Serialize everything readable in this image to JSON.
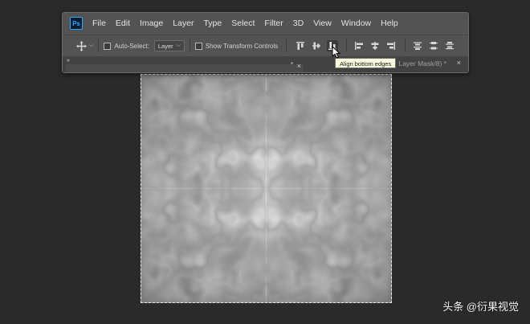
{
  "app": {
    "logo_text": "Ps"
  },
  "menu": [
    "File",
    "Edit",
    "Image",
    "Layer",
    "Type",
    "Select",
    "Filter",
    "3D",
    "View",
    "Window",
    "Help"
  ],
  "options_bar": {
    "tool_icon": "move-icon",
    "auto_select_label": "Auto-Select:",
    "auto_select_checked": false,
    "layer_dropdown_value": "Layer",
    "show_transform_label": "Show Transform Controls",
    "show_transform_checked": false,
    "align_buttons": [
      "align-top-edges-icon",
      "align-vertical-centers-icon",
      "align-bottom-edges-icon",
      "align-left-edges-icon",
      "align-horizontal-centers-icon",
      "align-right-edges-icon",
      "distribute-top-edges-icon",
      "distribute-vertical-centers-icon",
      "distribute-bottom-edges-icon"
    ]
  },
  "tabs": {
    "chevrons": "»",
    "tab1_modified": "*",
    "tab1_close": "×",
    "tab2_title": "Layer Mask/8) *",
    "tab2_close": "×"
  },
  "tooltip": {
    "text": "Align bottom edges"
  },
  "watermark": {
    "text": "头条 @衍果视觉"
  },
  "colors": {
    "workspace": "#2a2a2a",
    "panel": "#535353",
    "tooltip_bg": "#fbfbde",
    "logo_accent": "#31a8ff"
  }
}
